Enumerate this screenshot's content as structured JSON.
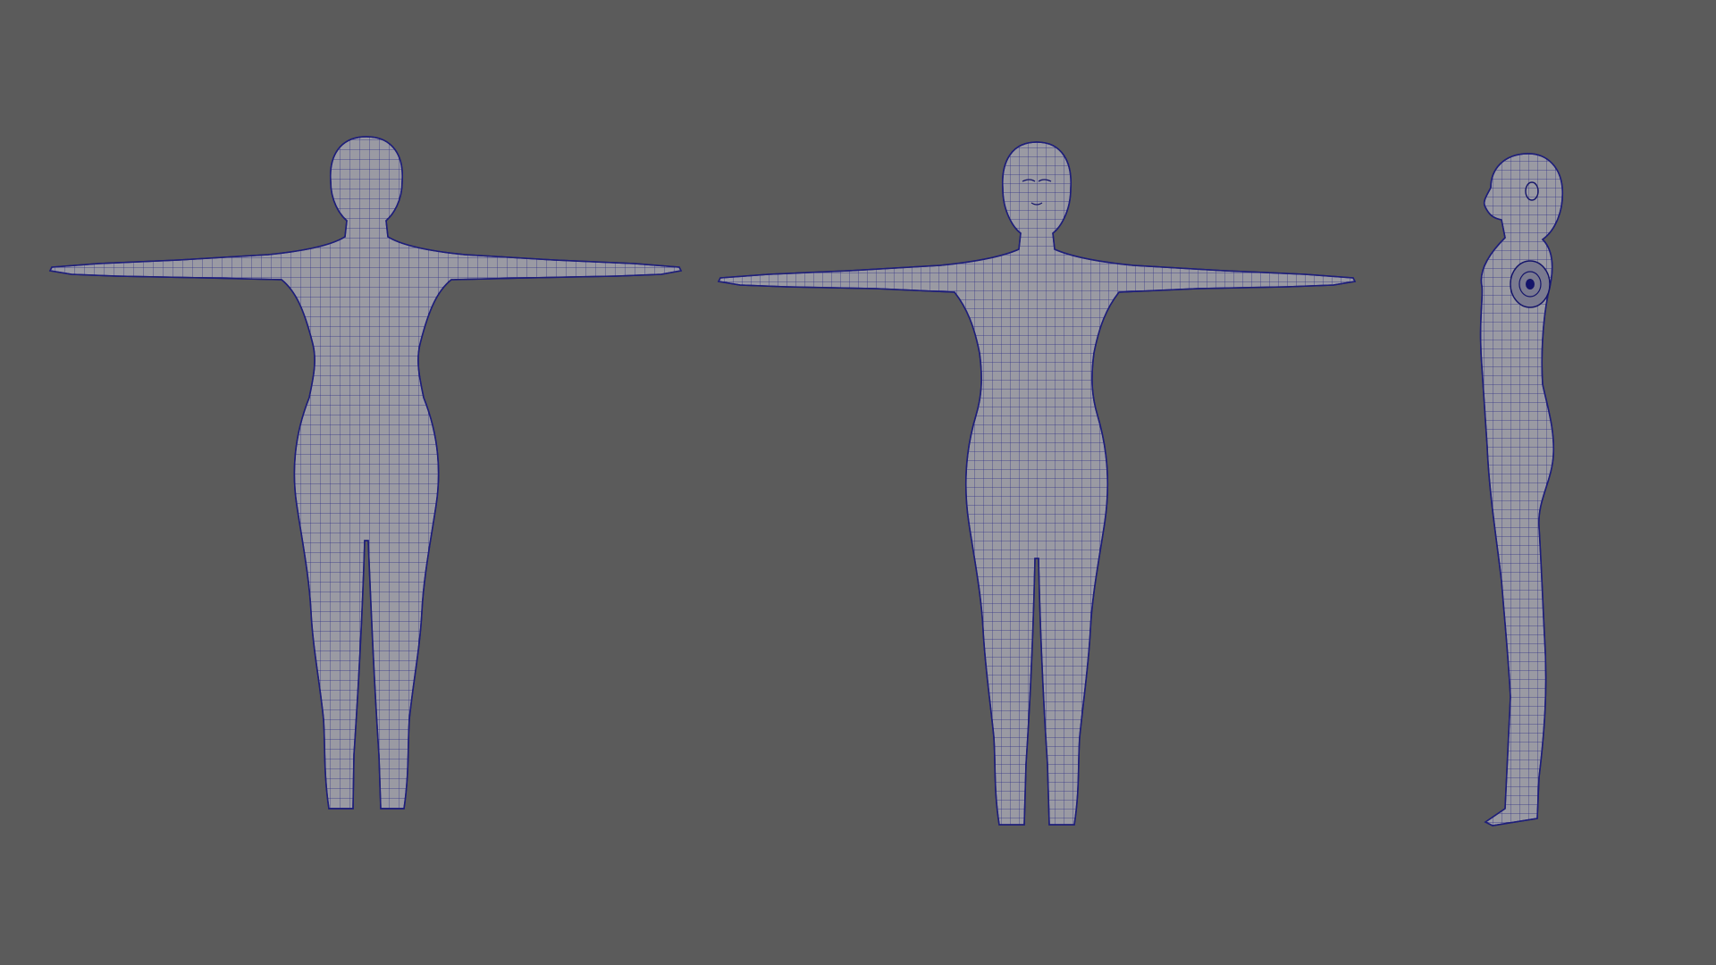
{
  "scene": {
    "background_color": "#5b5b5b",
    "mesh_fill_color": "#9a9aa3",
    "wireframe_color": "#1a1a80",
    "views": [
      {
        "view": "back",
        "pose": "t-pose"
      },
      {
        "view": "front",
        "pose": "t-pose"
      },
      {
        "view": "side",
        "pose": "t-pose"
      }
    ]
  }
}
